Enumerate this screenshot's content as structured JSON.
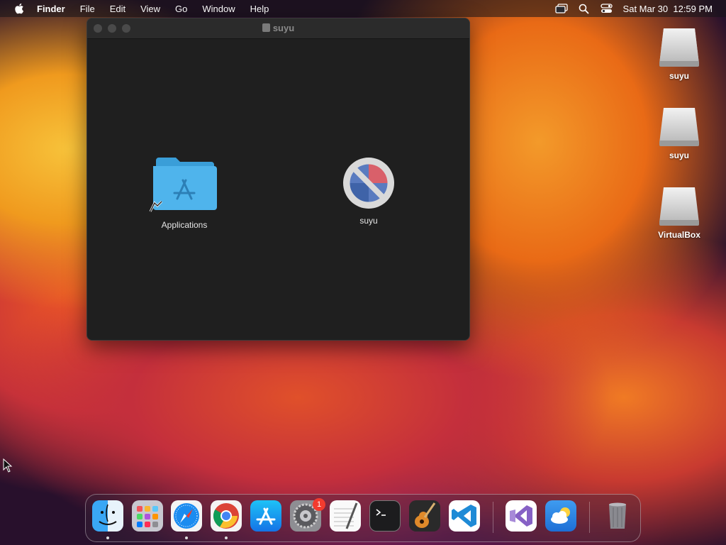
{
  "menubar": {
    "app_name": "Finder",
    "menus": [
      "File",
      "Edit",
      "View",
      "Go",
      "Window",
      "Help"
    ],
    "datetime": "Sat Mar 30  12:59 PM",
    "status_icons": [
      "screen-mirroring-icon",
      "spotlight-search-icon",
      "control-center-icon"
    ]
  },
  "window": {
    "title": "suyu",
    "items": [
      {
        "label": "Applications",
        "icon": "applications-folder-alias-icon"
      },
      {
        "label": "suyu",
        "icon": "prohibited-app-icon"
      }
    ]
  },
  "desktop": {
    "drives": [
      {
        "label": "suyu"
      },
      {
        "label": "suyu"
      },
      {
        "label": "VirtualBox"
      }
    ]
  },
  "dock": {
    "apps": [
      {
        "name": "Finder",
        "icon": "finder-icon",
        "running": true
      },
      {
        "name": "Launchpad",
        "icon": "launchpad-icon",
        "running": false
      },
      {
        "name": "Safari",
        "icon": "safari-icon",
        "running": true
      },
      {
        "name": "Google Chrome",
        "icon": "chrome-icon",
        "running": true
      },
      {
        "name": "App Store",
        "icon": "app-store-icon",
        "running": false
      },
      {
        "name": "System Preferences",
        "icon": "system-preferences-icon",
        "running": false,
        "badge": "1"
      },
      {
        "name": "TextEdit",
        "icon": "textedit-icon",
        "running": false
      },
      {
        "name": "Terminal",
        "icon": "terminal-icon",
        "running": false
      },
      {
        "name": "GarageBand",
        "icon": "garageband-icon",
        "running": false
      },
      {
        "name": "Visual Studio Code",
        "icon": "vscode-icon",
        "running": false
      },
      {
        "name": "Visual Studio",
        "icon": "visual-studio-icon",
        "running": false
      },
      {
        "name": "Weather",
        "icon": "weather-icon",
        "running": false
      },
      {
        "name": "Trash",
        "icon": "trash-icon",
        "running": false
      }
    ]
  },
  "colors": {
    "window_bg": "#1f1f1f",
    "folder_blue": "#3fa9e6",
    "badge_red": "#f23b2e"
  }
}
